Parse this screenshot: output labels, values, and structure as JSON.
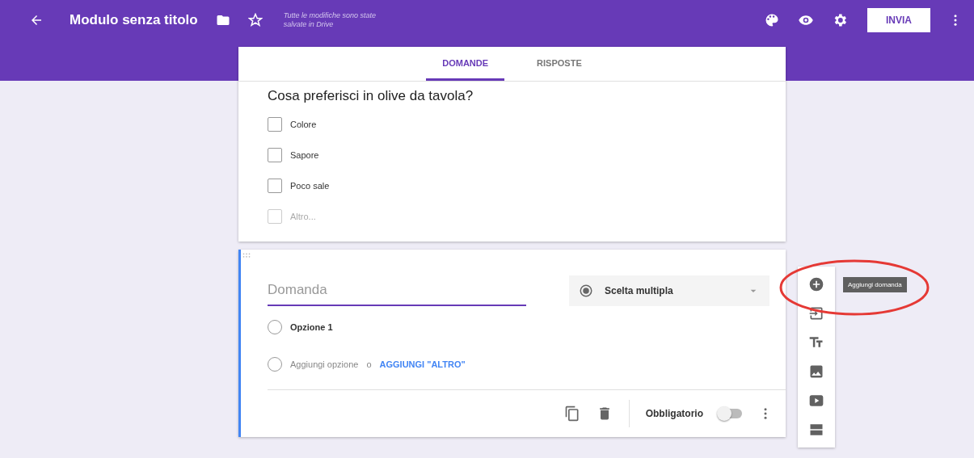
{
  "header": {
    "title": "Modulo senza titolo",
    "save_status": "Tutte le modifiche sono state salvate in Drive",
    "send_button": "INVIA"
  },
  "tabs": [
    {
      "label": "DOMANDE",
      "selected": true
    },
    {
      "label": "RISPOSTE",
      "selected": false
    }
  ],
  "question": {
    "title": "Cosa preferisci in olive da tavola?",
    "options": [
      {
        "label": "Colore",
        "checked": false,
        "kind": "option"
      },
      {
        "label": "Sapore",
        "checked": false,
        "kind": "option"
      },
      {
        "label": "Poco sale",
        "checked": false,
        "kind": "option"
      },
      {
        "label": "Altro...",
        "checked": false,
        "kind": "other"
      }
    ]
  },
  "editor": {
    "placeholder": "Domanda",
    "type": "Scelta multipla",
    "option": "Opzione 1",
    "add_option": "Aggiungi opzione",
    "or": "o",
    "add_other": "AGGIUNGI \"ALTRO\"",
    "required_label": "Obbligatorio",
    "required_on": false
  },
  "tooltip": "Aggiungi domanda"
}
